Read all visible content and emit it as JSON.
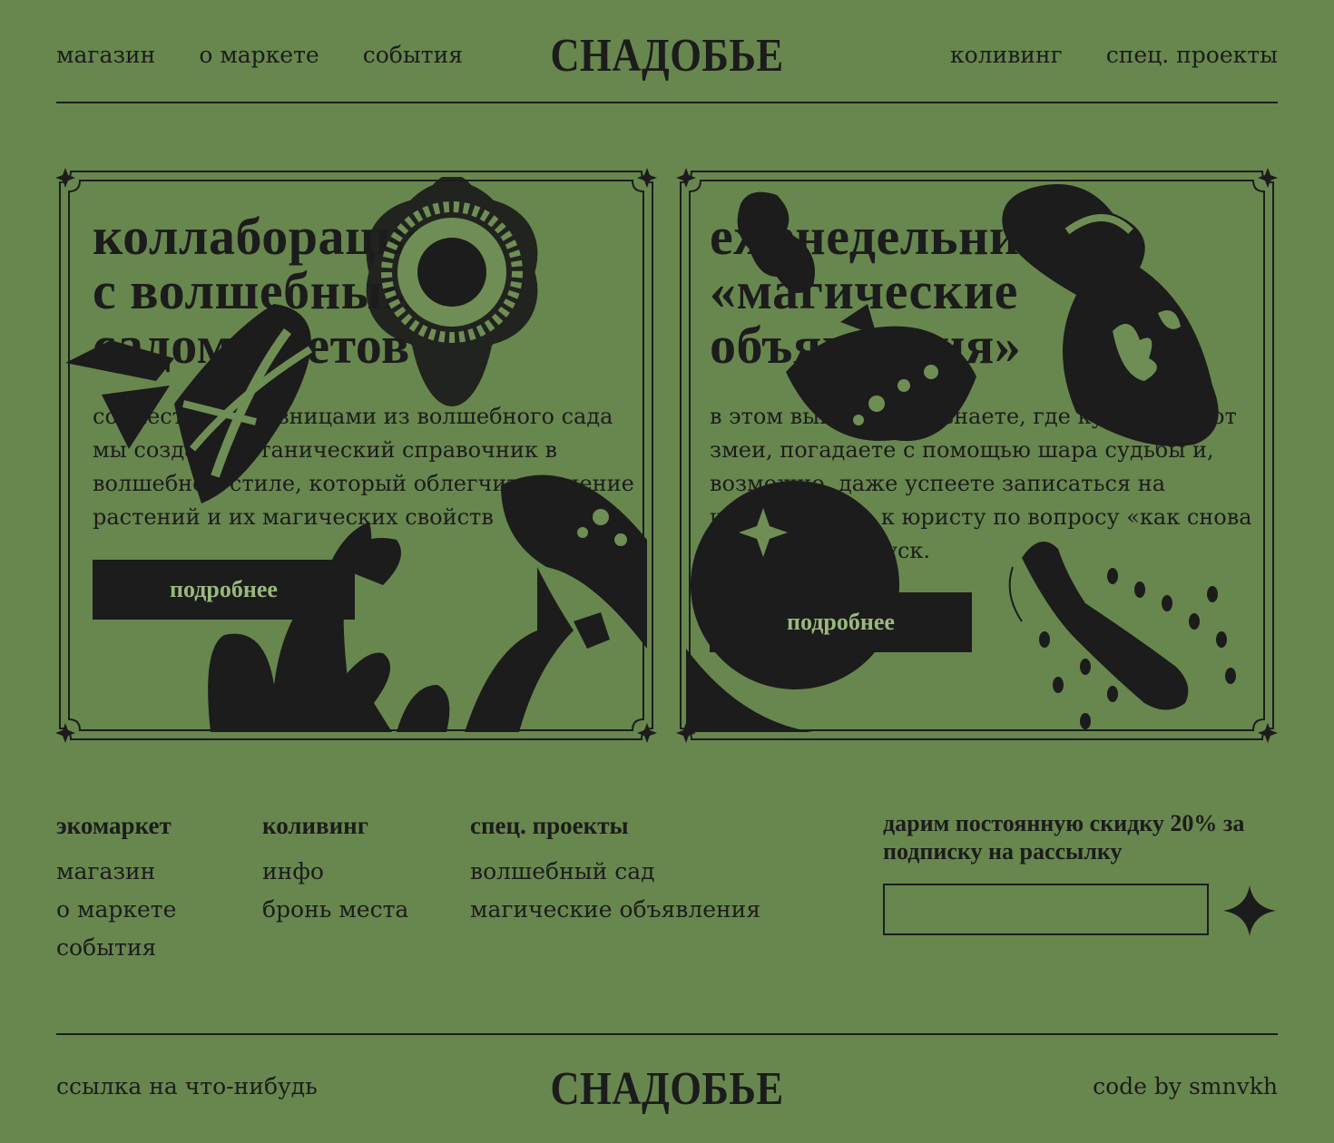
{
  "colors": {
    "background": "#68874f",
    "ink": "#1c1c1c",
    "button_text": "#9bb87d"
  },
  "header": {
    "logo": "СНАДОБЬЕ",
    "nav_left": [
      "магазин",
      "о маркете",
      "события"
    ],
    "nav_right": [
      "коливинг",
      "спец. проекты"
    ]
  },
  "cards": [
    {
      "title": "коллаборация\nс волшебным\nсадом цветов",
      "text": "совместно с травницами из волшебного сада мы создали ботанический справочник в волшебном стиле, который облегчит изучение растений и их магических свойств",
      "button": "подробнее",
      "illustration_icons": [
        "flower-icon",
        "bow-icon",
        "cactus-icon",
        "mushroom-icon"
      ]
    },
    {
      "title": "еженедельник\n«магические\nобъявления»",
      "text": "в этом выпуске вы узнаете, где купить шепот змеи, погадаете с помощью шара судьбы и, возможно, даже успеете записаться на консультацию к юристу по вопросу «как снова не уехать в отпуск.",
      "button": "подробнее",
      "illustration_icons": [
        "vase-icon",
        "crystal-ball-icon",
        "potion-icon",
        "bone-icon"
      ]
    }
  ],
  "footer": {
    "columns": [
      {
        "heading": "экомаркет",
        "links": [
          "магазин",
          "о маркете",
          "события"
        ]
      },
      {
        "heading": "коливинг",
        "links": [
          "инфо",
          "бронь места"
        ]
      },
      {
        "heading": "спец. проекты",
        "links": [
          "волшебный сад",
          "магические объявления"
        ]
      }
    ],
    "promo": "дарим постоянную скидку 20% за подписку на рассылку",
    "email_value": "",
    "send_icon": "sparkle-icon",
    "bottom_left": "ссылка на что-нибудь",
    "logo": "СНАДОБЬЕ",
    "bottom_right": "code by smnvkh"
  }
}
